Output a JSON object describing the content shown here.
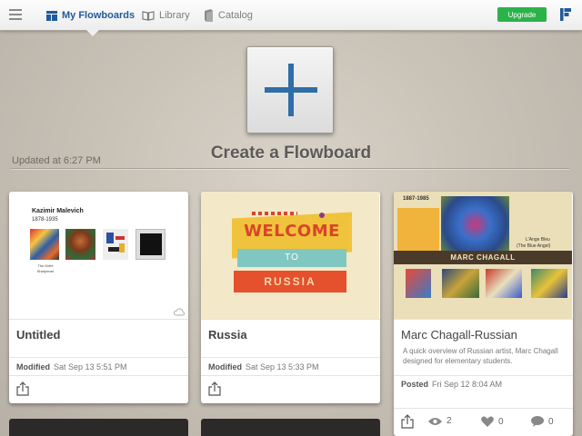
{
  "topbar": {
    "nav": [
      {
        "label": "My Flowboards",
        "icon": "flowboards-icon"
      },
      {
        "label": "Library",
        "icon": "book-icon"
      },
      {
        "label": "Catalog",
        "icon": "catalog-icon"
      }
    ],
    "upgrade_label": "Upgrade"
  },
  "main": {
    "create_label": "Create a Flowboard",
    "updated": "Updated at 6:27 PM"
  },
  "cards": [
    {
      "title": "Untitled",
      "meta_label": "Modified",
      "meta_value": "Sat Sep 13 5:51 PM",
      "thumb": {
        "heading": "Kazimir Malevich",
        "years": "1878-1935",
        "caption": "The Knife Sharpener"
      }
    },
    {
      "title": "Russia",
      "meta_label": "Modified",
      "meta_value": "Sat Sep 13 5:33 PM",
      "thumb": {
        "line1": "WELCOME",
        "line2": "TO",
        "line3": "RUSSIA"
      }
    },
    {
      "title": "Marc Chagall-Russian",
      "description": "A quick overview of Russian artist, Marc Chagall designed for elementary students.",
      "meta_label": "Posted",
      "meta_value": "Fri Sep 12 8:04 AM",
      "views": "2",
      "likes": "0",
      "comments": "0",
      "thumb": {
        "years": "1887-1985",
        "banner": "MARC CHAGALL",
        "painting_title": "L'Ange Bleu",
        "painting_subtitle": "(The Blue Angel)"
      }
    }
  ],
  "colors": {
    "accent": "#1f5b9a",
    "upgrade": "#2bb34a"
  }
}
